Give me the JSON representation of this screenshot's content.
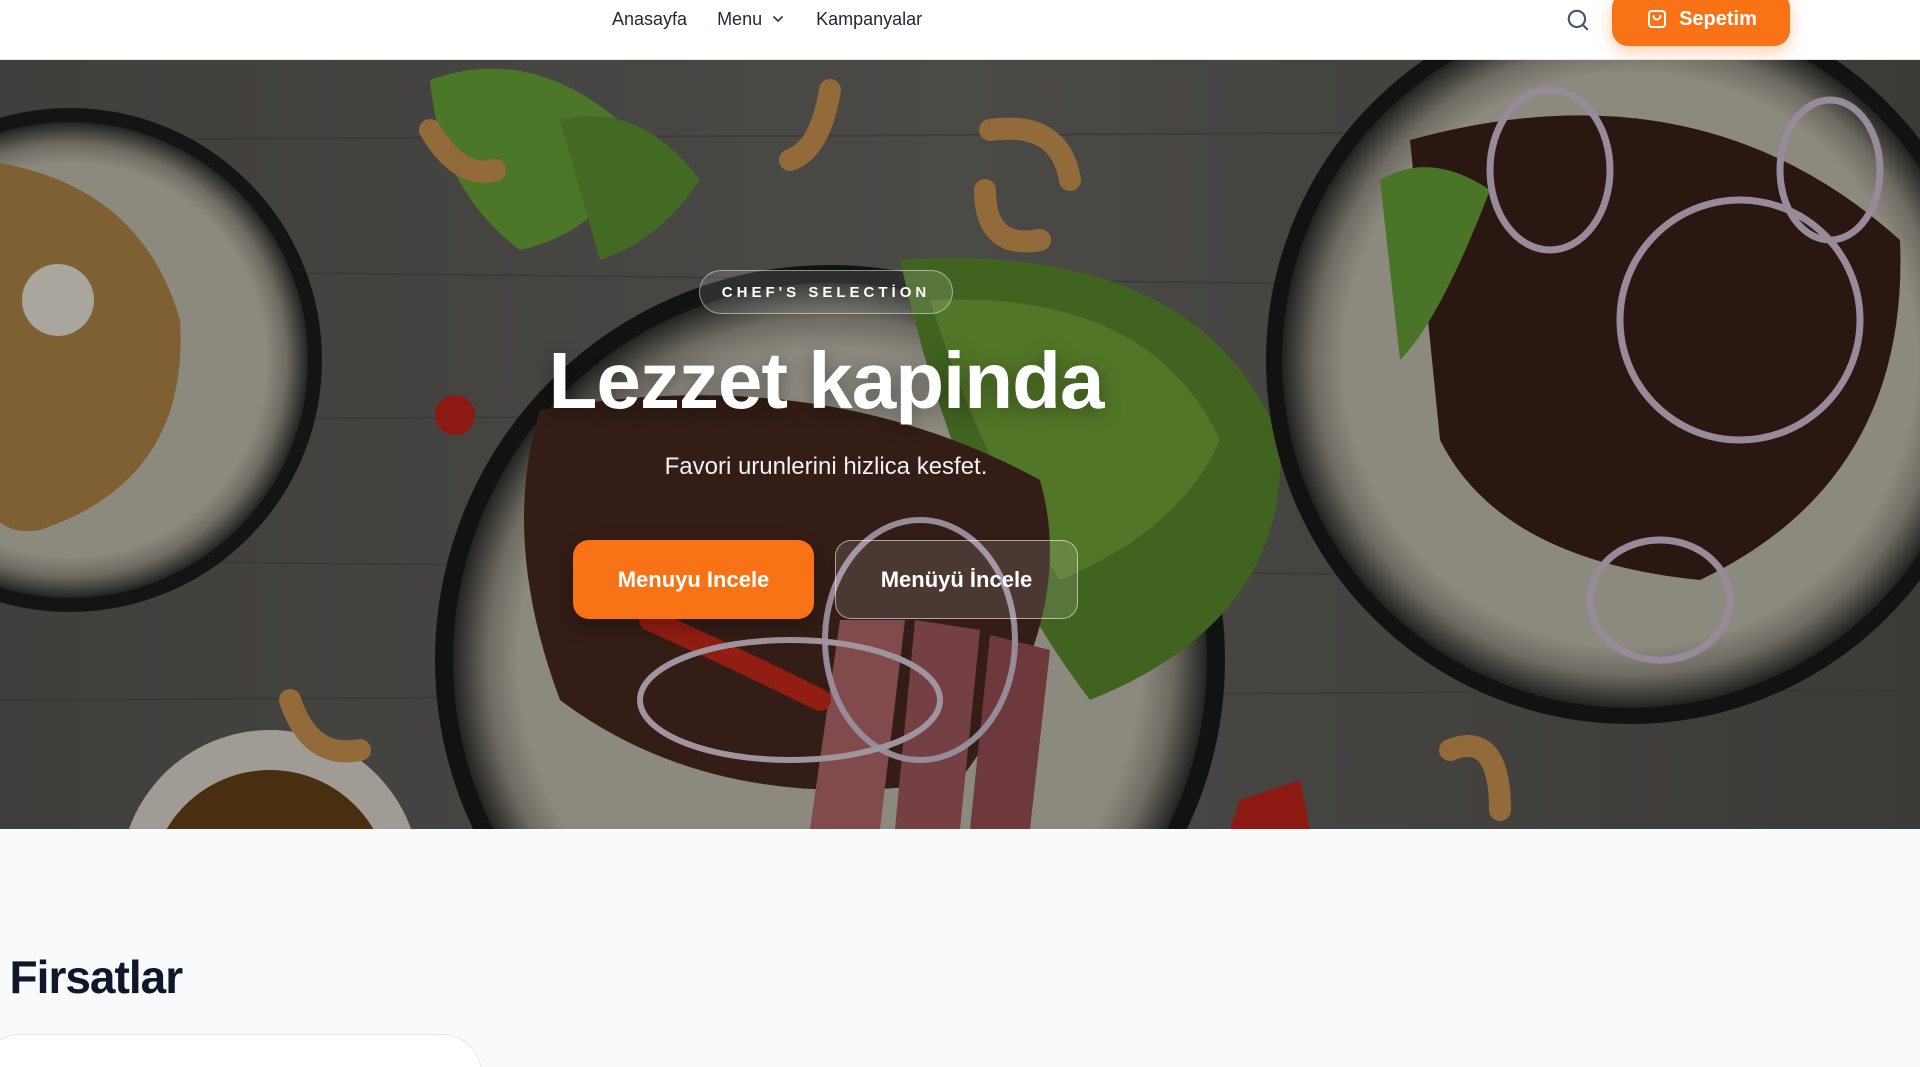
{
  "header": {
    "nav": [
      {
        "label": "Anasayfa"
      },
      {
        "label": "Menu",
        "has_dropdown": true
      },
      {
        "label": "Kampanyalar"
      }
    ],
    "search_icon": "search-icon",
    "cart_label": "Sepetim",
    "cart_icon": "shopping-bag-icon"
  },
  "hero": {
    "badge": "CHEF'S SELECTİON",
    "title": "Lezzet kapinda",
    "subtitle": "Favori urunlerini hizlica kesfet.",
    "primary_cta": "Menuyu Incele",
    "secondary_cta": "Menüyü İncele"
  },
  "section": {
    "title": "l Firsatlar"
  },
  "colors": {
    "accent": "#f97316",
    "text_dark": "#0f172a",
    "page_bg": "#f8fafc"
  }
}
